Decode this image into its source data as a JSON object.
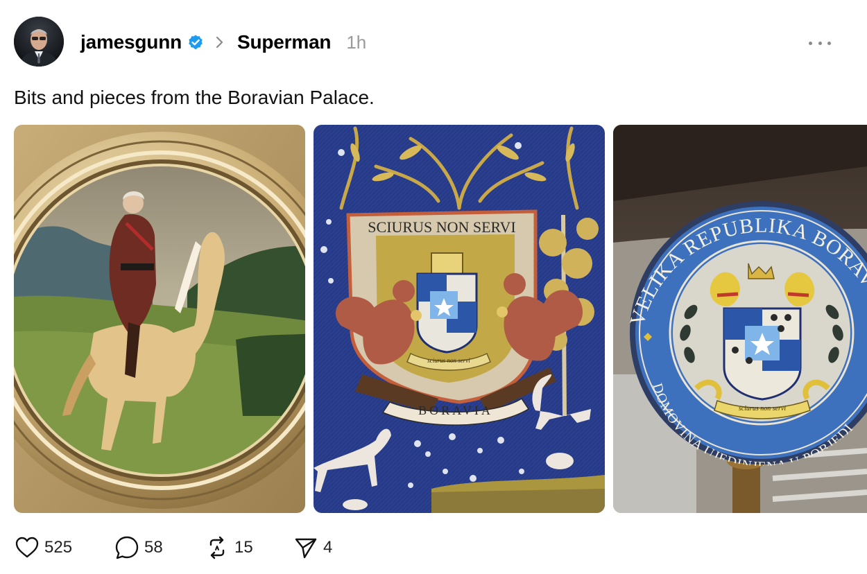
{
  "post": {
    "username": "jamesgunn",
    "verified": true,
    "topic": "Superman",
    "time": "1h",
    "text": "Bits and pieces from the Boravian Palace."
  },
  "images": {
    "panel2": {
      "motto": "SCIURUS NON SERVI",
      "banner": "BORAVIA",
      "ribbon": "sciurus non servi"
    },
    "panel3": {
      "seal_top": "VELIKA REPUBLIKA BORAVSKA",
      "seal_bottom": "DOMOVINA UJEDINJENA U POBJEDI",
      "ribbon": "sciurus non servi"
    }
  },
  "actions": {
    "likes": "525",
    "replies": "58",
    "reposts": "15",
    "shares": "4"
  },
  "icons": {
    "verified": "verified-badge-icon",
    "chevron": "chevron-right-icon",
    "more": "more-icon",
    "like": "heart-icon",
    "reply": "comment-icon",
    "repost": "repost-icon",
    "share": "send-icon"
  },
  "colors": {
    "verified": "#1d9bf0",
    "muted": "#9a9a9a",
    "text": "#000000"
  }
}
